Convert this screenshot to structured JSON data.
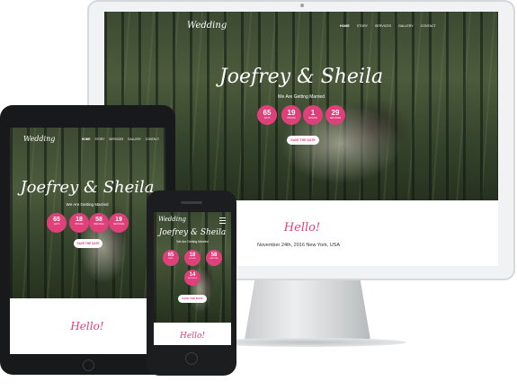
{
  "site": {
    "logo": "Wedding",
    "nav": [
      "HOME",
      "STORY",
      "SERVICES",
      "GALLERY",
      "CONTACT"
    ],
    "couple": "Joefrey & Sheila",
    "subtitle": "We Are Getting Married",
    "save_button": "SAVE THE DATE",
    "hello": "Hello!",
    "date_line": "November 24th, 2016 New York, USA"
  },
  "countdown_desktop": [
    {
      "value": "65",
      "label": "DAYS"
    },
    {
      "value": "19",
      "label": "HOURS"
    },
    {
      "value": "1",
      "label": "MINUTE"
    },
    {
      "value": "29",
      "label": "SECONDS"
    }
  ],
  "countdown_tablet": [
    {
      "value": "65",
      "label": "DAYS"
    },
    {
      "value": "18",
      "label": "HOURS"
    },
    {
      "value": "58",
      "label": "MINUTES"
    },
    {
      "value": "19",
      "label": "SECONDS"
    }
  ],
  "countdown_phone": [
    {
      "value": "65",
      "label": "DAYS"
    },
    {
      "value": "18",
      "label": "HOURS"
    },
    {
      "value": "58",
      "label": "MINUTES"
    },
    {
      "value": "14",
      "label": "SECONDS"
    }
  ],
  "colors": {
    "accent": "#e0407a",
    "device_dark": "#17191b",
    "device_light": "#f1f2f3"
  }
}
